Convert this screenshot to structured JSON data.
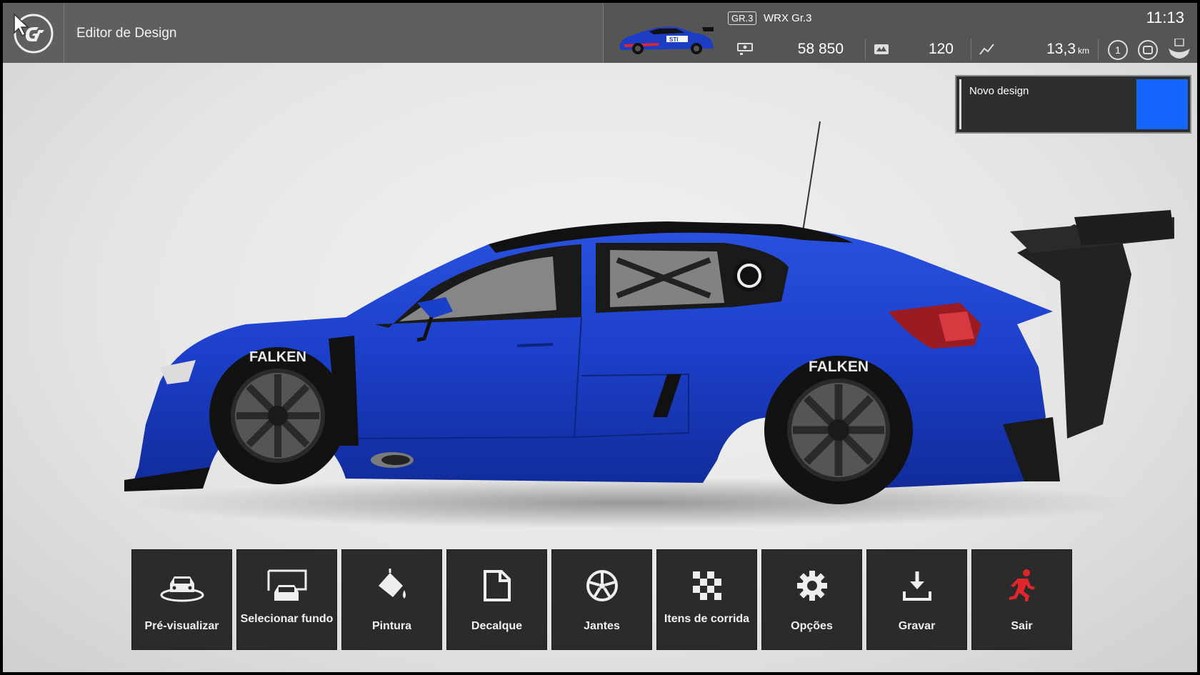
{
  "header": {
    "title": "Editor de Design",
    "car_grade": "GR.3",
    "car_name": "WRX Gr.3",
    "time": "11:13",
    "credits": "58 850",
    "level": "120",
    "distance": "13,3",
    "distance_unit": "km",
    "notifications": "1"
  },
  "design": {
    "name": "Novo design",
    "swatch_primary": "#1565ff",
    "swatch_accent": "#e8157f"
  },
  "car": {
    "tire_brand": "FALKEN",
    "body_color": "#1a3fc8"
  },
  "menu": [
    {
      "label": "Pré-visualizar",
      "icon": "car-preview-icon"
    },
    {
      "label": "Selecionar fundo",
      "icon": "background-select-icon"
    },
    {
      "label": "Pintura",
      "icon": "paint-bucket-icon"
    },
    {
      "label": "Decalque",
      "icon": "decal-page-icon"
    },
    {
      "label": "Jantes",
      "icon": "wheel-icon"
    },
    {
      "label": "Itens de corrida",
      "icon": "checkered-flag-icon"
    },
    {
      "label": "Opções",
      "icon": "gear-icon"
    },
    {
      "label": "Gravar",
      "icon": "download-icon"
    },
    {
      "label": "Sair",
      "icon": "exit-runner-icon",
      "color": "#e0262b"
    }
  ]
}
